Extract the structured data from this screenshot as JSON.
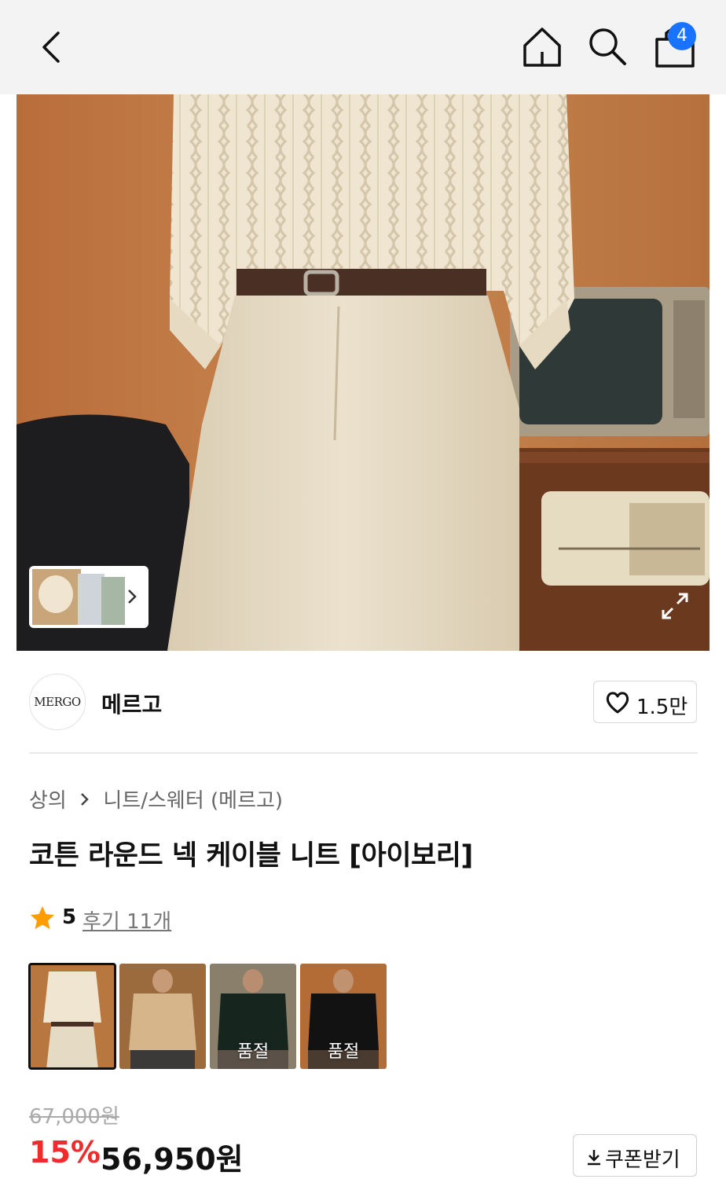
{
  "header": {
    "back_icon": "chevron-left-icon",
    "home_icon": "home-icon",
    "search_icon": "search-icon",
    "cart_icon": "shopping-bag-icon",
    "cart_count": "4",
    "badge_color": "#1a73ff"
  },
  "hero": {
    "thumbnail_more_icon": "chevron-right-icon",
    "expand_icon": "expand-icon"
  },
  "brand": {
    "logo_text": "MERGO",
    "name": "메르고",
    "like_icon": "heart-icon",
    "like_count": "1.5만"
  },
  "breadcrumb": {
    "category": "상의",
    "separator_icon": "chevron-right-icon",
    "subcategory": "니트/스웨터 (메르고)"
  },
  "product": {
    "title": "코튼 라운드 넥 케이블 니트 [아이보리]",
    "rating_icon": "star-icon",
    "rating": "5",
    "review_link": "후기 11개",
    "star_color": "#ff9d00"
  },
  "options": [
    {
      "label": "",
      "selected": true,
      "sold_out": false
    },
    {
      "label": "",
      "selected": false,
      "sold_out": false
    },
    {
      "label": "품절",
      "selected": false,
      "sold_out": true
    },
    {
      "label": "품절",
      "selected": false,
      "sold_out": true
    }
  ],
  "price": {
    "original": "67,000원",
    "discount": "15%",
    "sale": "56,950원",
    "discount_color": "#ef2b2b",
    "coupon_icon": "download-icon",
    "coupon_label": "쿠폰받기"
  }
}
